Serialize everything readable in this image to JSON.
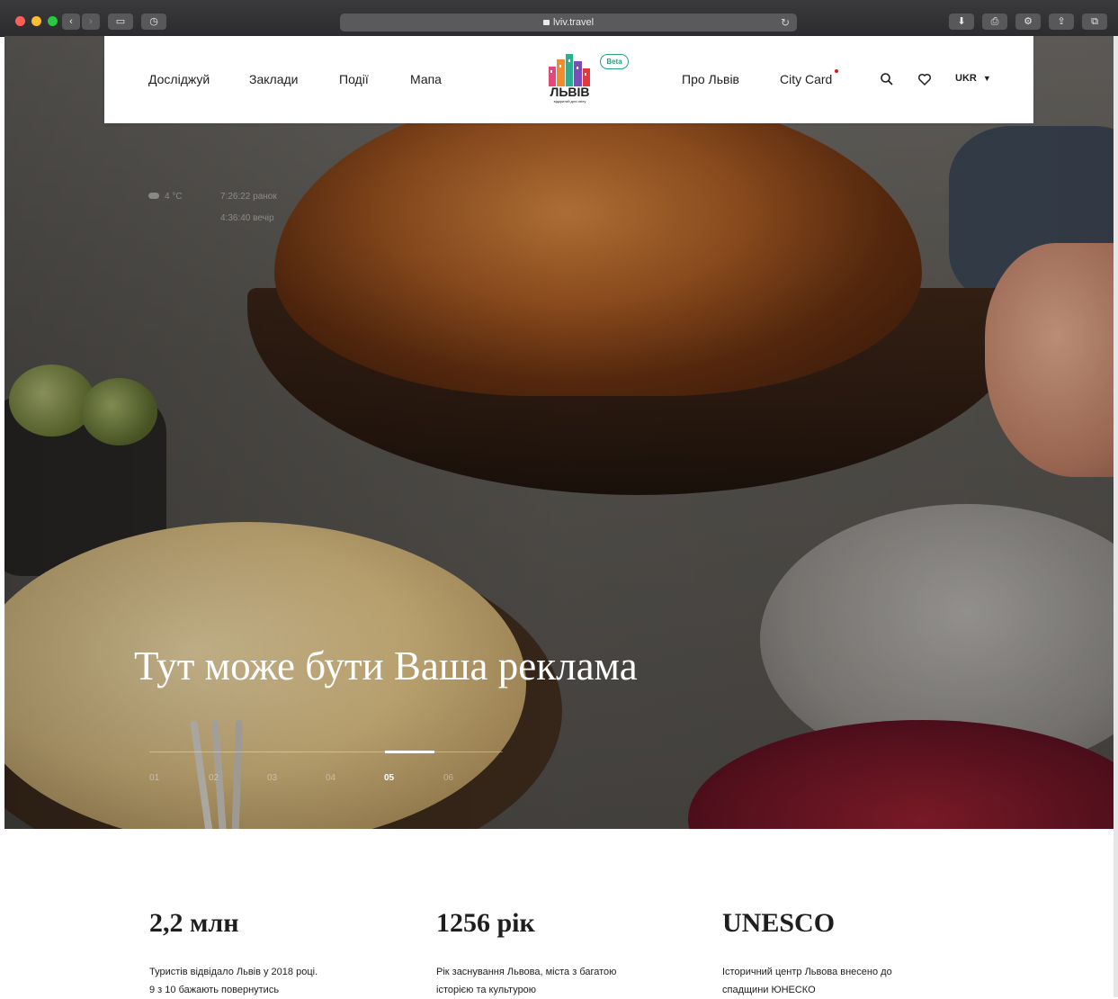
{
  "browser": {
    "url": "lviv.travel"
  },
  "header": {
    "nav_left": [
      "Досліджуй",
      "Заклади",
      "Події",
      "Мапа"
    ],
    "logo_text": "ЛЬВІВ",
    "logo_tagline": "відкритий для світу",
    "beta_label": "Beta",
    "nav_right": [
      "Про Львів",
      "City Card"
    ],
    "language": "UKR"
  },
  "weather": {
    "temperature": "4 °C",
    "sunrise": "7:26:22 ранок",
    "sunset": "4:36:40 вечір"
  },
  "hero": {
    "title": "Тут може бути Ваша реклама",
    "slides": [
      "01",
      "02",
      "03",
      "04",
      "05",
      "06"
    ],
    "active_slide": "05"
  },
  "stats": [
    {
      "value": "2,2 млн",
      "text": [
        "Туристів відвідало Львів у 2018 році.",
        "9 з 10 бажають повернутись"
      ]
    },
    {
      "value": "1256 рік",
      "text": [
        "Рік заснування Львова, міста з багатою",
        "історією та культурою"
      ]
    },
    {
      "value": "UNESCO",
      "text": [
        "Історичний центр Львова внесено до",
        "спадщини ЮНЕСКО"
      ]
    }
  ],
  "colors": {
    "brand_green": "#24a37e",
    "notify_red": "#e3151a",
    "text_dark": "#1e1e1e"
  },
  "icons": [
    "search-icon",
    "heart-icon",
    "caret-down-icon",
    "download-icon",
    "print-icon",
    "settings-icon",
    "share-icon",
    "tabs-icon"
  ]
}
